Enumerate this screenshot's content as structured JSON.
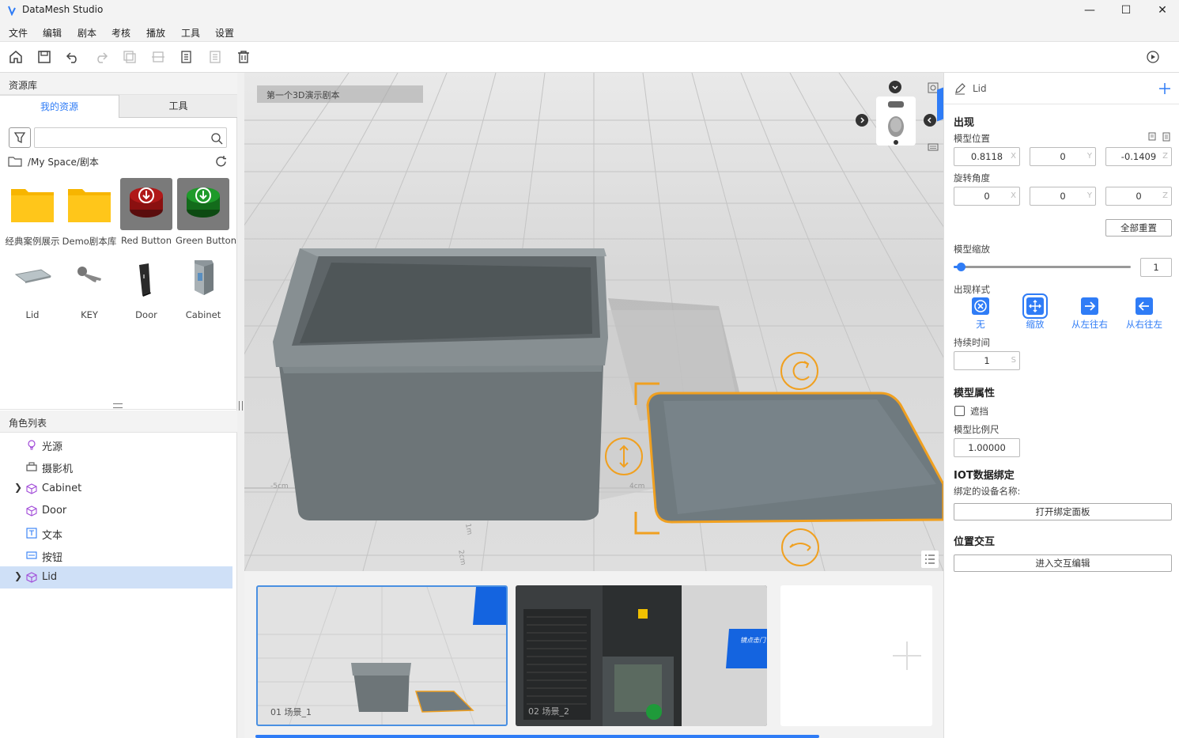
{
  "app": {
    "title": "DataMesh Studio"
  },
  "menu": [
    "文件",
    "编辑",
    "剧本",
    "考核",
    "播放",
    "工具",
    "设置"
  ],
  "left": {
    "resource_header": "资源库",
    "tabs": [
      "我的资源",
      "工具"
    ],
    "path": "/My Space/剧本",
    "search_placeholder": "",
    "assets": [
      {
        "label": "经典案例展示",
        "kind": "folder"
      },
      {
        "label": "Demo剧本库",
        "kind": "folder"
      },
      {
        "label": "Red Button",
        "kind": "red-button"
      },
      {
        "label": "Green Button",
        "kind": "green-button"
      },
      {
        "label": "Lid",
        "kind": "lid"
      },
      {
        "label": "KEY",
        "kind": "key"
      },
      {
        "label": "Door",
        "kind": "door"
      },
      {
        "label": "Cabinet",
        "kind": "cabinet"
      }
    ],
    "role_header": "角色列表",
    "roles": [
      {
        "label": "光源",
        "icon": "light-bulb-icon"
      },
      {
        "label": "摄影机",
        "icon": "camera-icon"
      },
      {
        "label": "Cabinet",
        "icon": "cube-icon"
      },
      {
        "label": "Door",
        "icon": "cube-icon"
      },
      {
        "label": "文本",
        "icon": "text-icon"
      },
      {
        "label": "按钮",
        "icon": "button-icon"
      },
      {
        "label": "Lid",
        "icon": "cube-icon"
      }
    ]
  },
  "viewport": {
    "script_name": "第一个3D演示剧本",
    "ruler_labels": [
      "-5cm",
      "4cm",
      "1m",
      "2cm"
    ]
  },
  "scenes": [
    {
      "label": "01  场景_1",
      "badge": ""
    },
    {
      "label": "02  场景_2",
      "badge": "镜点击门"
    }
  ],
  "right": {
    "object_name": "Lid",
    "appear_header": "出现",
    "position_label": "模型位置",
    "position": {
      "x": "0.8118",
      "y": "0",
      "z": "-0.1409"
    },
    "rotation_label": "旋转角度",
    "rotation": {
      "x": "0",
      "y": "0",
      "z": "0"
    },
    "reset_all": "全部重置",
    "scale_label": "模型缩放",
    "scale_value": "1",
    "scale_fraction": 0.02,
    "appear_style_label": "出现样式",
    "styles": [
      "无",
      "缩放",
      "从左往右",
      "从右往左"
    ],
    "duration_label": "持续时间",
    "duration_value": "1",
    "duration_unit": "S",
    "model_props_header": "模型属性",
    "occlude_label": "遮挡",
    "model_ratio_label": "模型比例尺",
    "model_ratio_value": "1.00000",
    "iot_header": "IOT数据绑定",
    "iot_device_label": "绑定的设备名称:",
    "open_bind_panel": "打开绑定面板",
    "interaction_header": "位置交互",
    "enter_interaction": "进入交互编辑",
    "axes": [
      "X",
      "Y",
      "Z"
    ]
  },
  "colors": {
    "accent": "#2f7cf6",
    "gizmo": "#f0a020",
    "selected_row": "#cfe0f7"
  }
}
